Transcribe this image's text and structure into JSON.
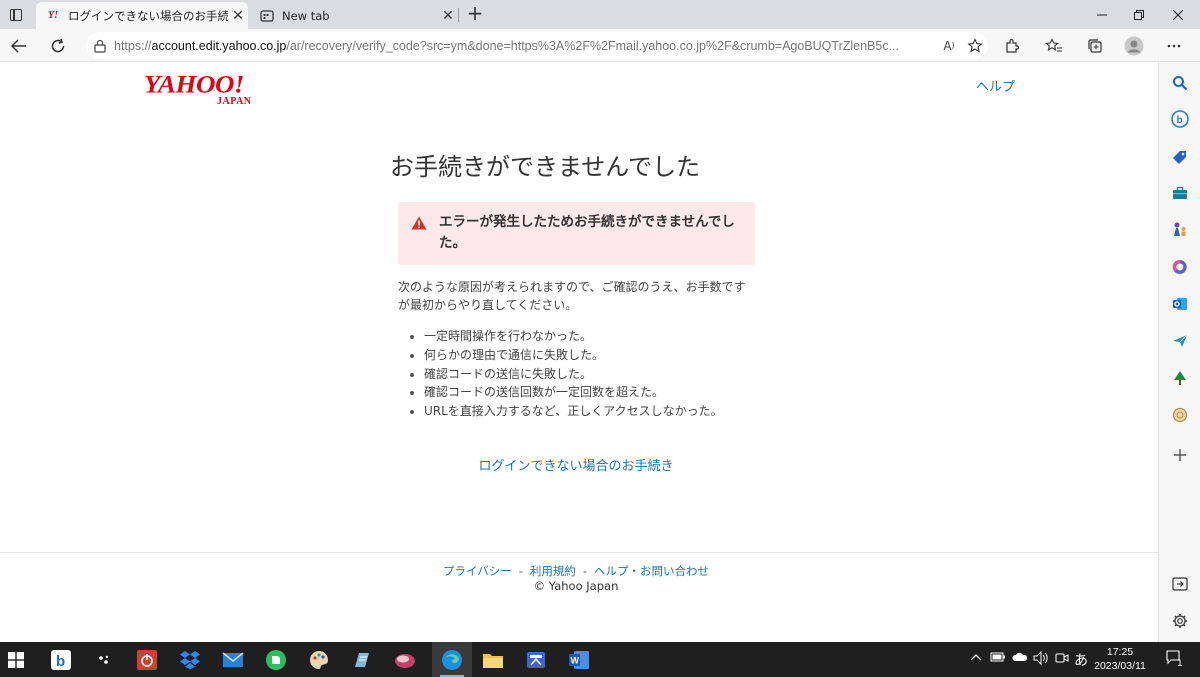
{
  "browser": {
    "tabs": [
      {
        "title": "ログインできない場合のお手続き - Ya",
        "favicon": "yahoo-y-icon",
        "active": true
      },
      {
        "title": "New tab",
        "favicon": "new-tab-icon",
        "active": false
      }
    ],
    "address": {
      "scheme": "https://",
      "host": "account.edit.yahoo.co.jp",
      "path": "/ar/recovery/verify_code?src=ym&done=https%3A%2F%2Fmail.yahoo.co.jp%2F&crumb=AgoBUQTrZlenB5c..."
    }
  },
  "page": {
    "logo": {
      "main": "YAHOO!",
      "sub": "JAPAN"
    },
    "help": "ヘルプ",
    "heading": "お手続きができませんでした",
    "alert": "エラーが発生したためお手続きができませんでした。",
    "description": "次のような原因が考えられますので、ご確認のうえ、お手数ですが最初からやり直してください。",
    "reasons": [
      "一定時間操作を行わなかった。",
      "何らかの理由で通信に失敗した。",
      "確認コードの送信に失敗した。",
      "確認コードの送信回数が一定回数を超えた。",
      "URLを直接入力するなど、正しくアクセスしなかった。"
    ],
    "login_help_link": "ログインできない場合のお手続き"
  },
  "footer": {
    "links": [
      "プライバシー",
      "利用規約",
      "ヘルプ・お問い合わせ"
    ],
    "separator": "-",
    "copyright": "© Yahoo Japan"
  },
  "taskbar": {
    "time": "17:25",
    "date": "2023/03/11",
    "ime": "あ",
    "notifications": "1"
  },
  "colors": {
    "yahoo_red": "#e60012",
    "link_blue": "#1a73b9",
    "alert_bg": "#fde9e9",
    "alert_icon": "#d93025"
  }
}
